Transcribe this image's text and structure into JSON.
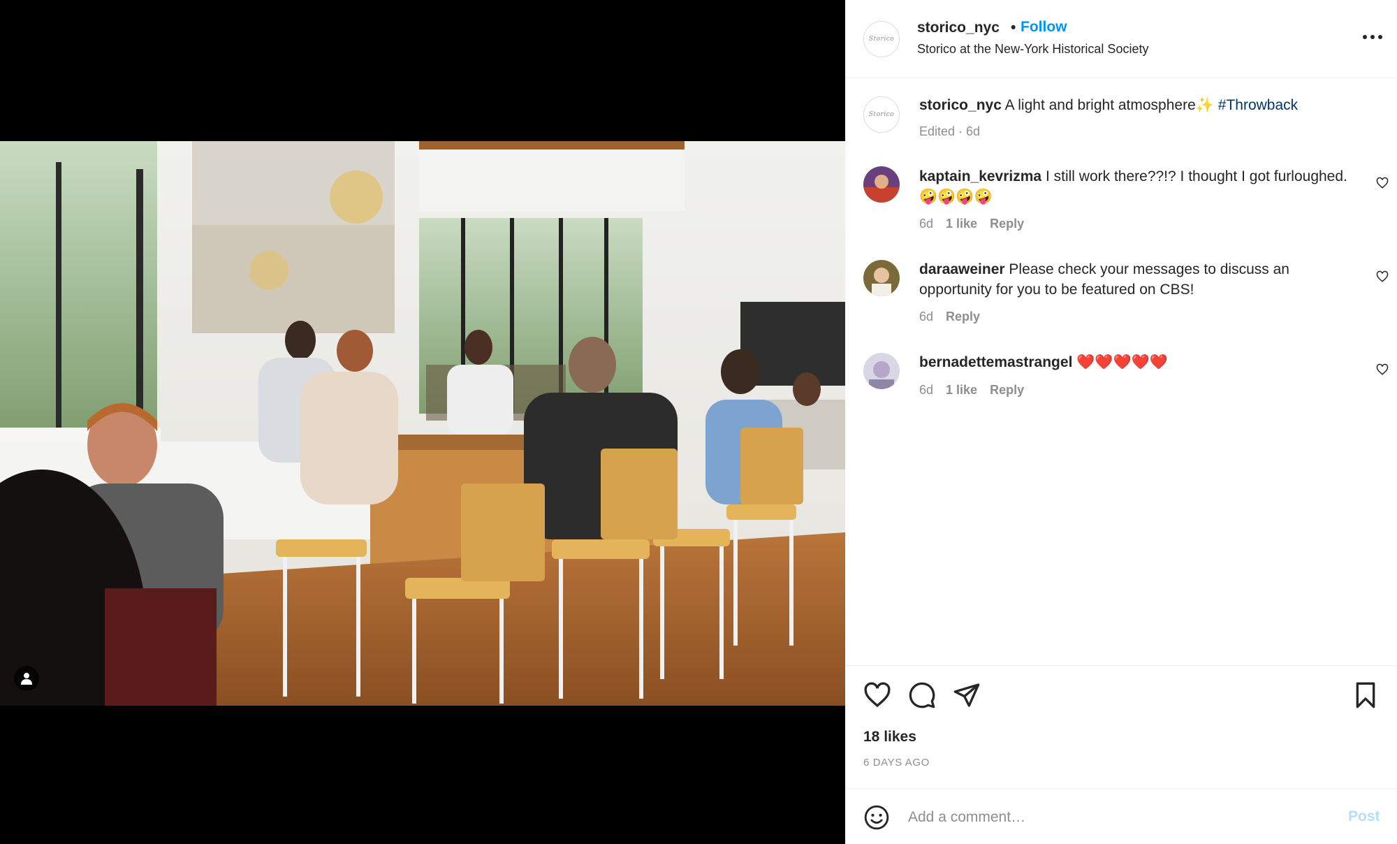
{
  "post": {
    "username": "storico_nyc",
    "dot": "•",
    "follow_label": "Follow",
    "location": "Storico at the New-York Historical Society",
    "avatar_text": "Storico",
    "more_label": "•••"
  },
  "caption": {
    "username": "storico_nyc",
    "text": "A light and bright atmosphere",
    "sparkle": "✨",
    "hashtag": "#Throwback",
    "meta": "Edited · 6d"
  },
  "comments": [
    {
      "username": "kaptain_kevrizma",
      "text": "I still work there??!? I thought I got furloughed. 🤪🤪🤪🤪",
      "time": "6d",
      "likes": "1 like",
      "reply": "Reply"
    },
    {
      "username": "daraaweiner",
      "text": "Please check your messages to discuss an opportunity for you to be featured on CBS!",
      "time": "6d",
      "likes": "",
      "reply": "Reply"
    },
    {
      "username": "bernadettemastrangel",
      "text": "❤️❤️❤️❤️❤️",
      "time": "6d",
      "likes": "1 like",
      "reply": "Reply"
    }
  ],
  "actions": {
    "like_icon": "heart-icon",
    "comment_icon": "comment-bubble-icon",
    "share_icon": "paper-plane-icon",
    "save_icon": "bookmark-icon",
    "likes_count": "18 likes",
    "time_ago": "6 DAYS AGO"
  },
  "add_comment": {
    "placeholder": "Add a comment…",
    "post_label": "Post"
  },
  "colors": {
    "link_blue": "#0095f6",
    "hashtag": "#00376b",
    "muted": "#8e8e8e",
    "post_disabled": "#b2dffc"
  }
}
